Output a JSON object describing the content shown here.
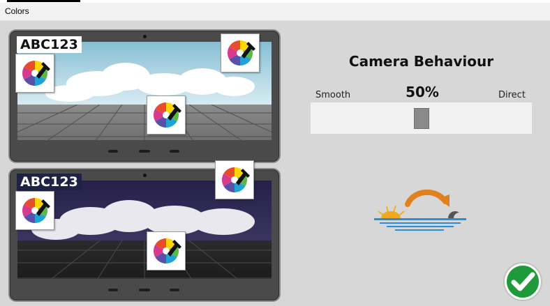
{
  "window": {
    "title": "Colors"
  },
  "previews": {
    "day": {
      "label": "ABC123"
    },
    "night": {
      "label": "ABC123"
    }
  },
  "camera": {
    "title": "Camera Behaviour",
    "left_label": "Smooth",
    "right_label": "Direct",
    "value_text": "50%",
    "value_fraction": 0.5
  },
  "icons": {
    "color_picker": "color-wheel-eyedropper-icon",
    "transition": "sun-swap-icon",
    "confirm": "checkmark-icon"
  },
  "colors": {
    "confirm_green": "#1e9a3a",
    "arrow_orange": "#e0801e",
    "water_blue": "#2a8fd6"
  }
}
